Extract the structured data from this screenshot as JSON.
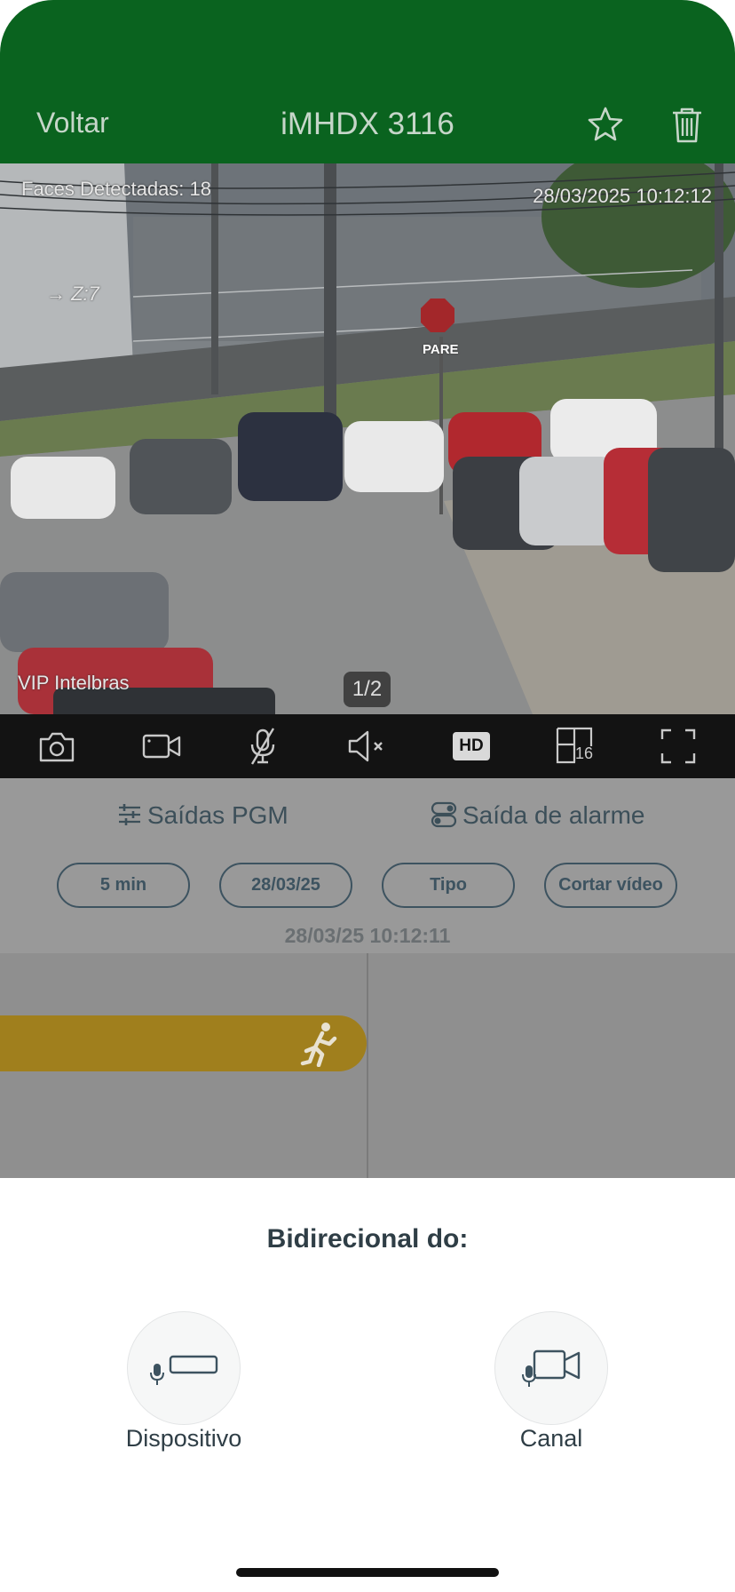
{
  "header": {
    "back_label": "Voltar",
    "title": "iMHDX 3116",
    "favorite_icon": "star-outline-icon",
    "delete_icon": "trash-icon",
    "background": "#0a631f"
  },
  "video": {
    "faces_overlay": "Faces Detectadas: 18",
    "timestamp_overlay": "28/03/2025 10:12:12",
    "zoom_overlay": "→ Z:7",
    "camera_name_overlay": "VIP Intelbras",
    "stop_sign_text": "PARE",
    "page_indicator": "1/2"
  },
  "toolbar": {
    "snapshot_icon": "camera-icon",
    "record_icon": "video-camera-icon",
    "mic_icon": "microphone-muted-icon",
    "speaker_icon": "speaker-muted-icon",
    "hd_label": "HD",
    "grid_label": "16",
    "fullscreen_icon": "fullscreen-icon"
  },
  "outputs": {
    "pgm_label": "Saídas PGM",
    "alarm_label": "Saída de alarme"
  },
  "filters": [
    {
      "label": "5 min"
    },
    {
      "label": "28/03/25"
    },
    {
      "label": "Tipo"
    },
    {
      "label": "Cortar vídeo"
    }
  ],
  "timeline": {
    "current_time": "28/03/25 10:12:11",
    "event_icon": "running-person-icon",
    "event_color": "#a07f1d"
  },
  "sheet": {
    "title": "Bidirecional do:",
    "options": [
      {
        "label": "Dispositivo",
        "icon": "device-microphone-icon"
      },
      {
        "label": "Canal",
        "icon": "channel-camera-microphone-icon"
      }
    ]
  }
}
